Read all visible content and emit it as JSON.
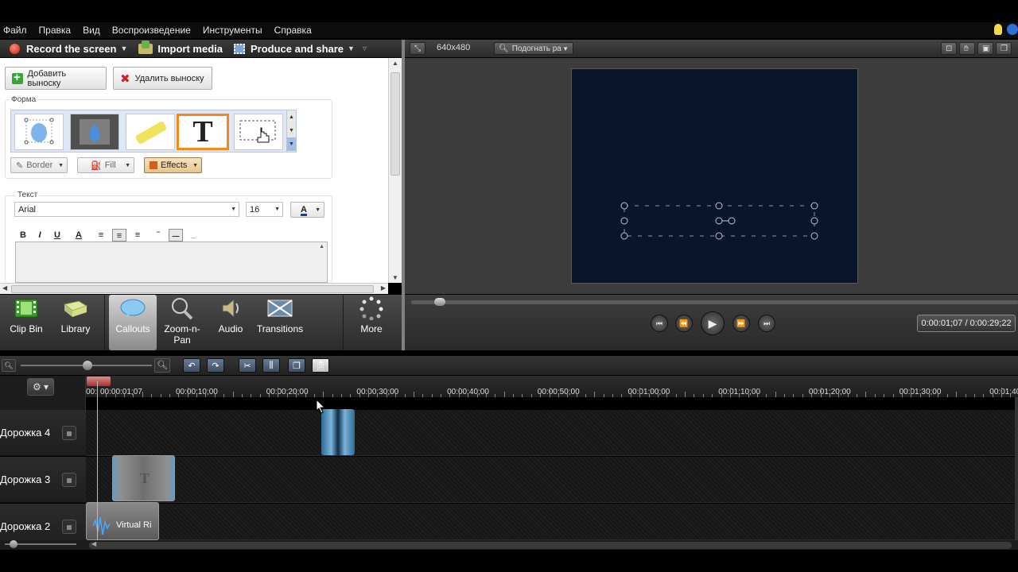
{
  "menu": [
    "Файл",
    "Правка",
    "Вид",
    "Воспроизведение",
    "Инструменты",
    "Справка"
  ],
  "toolbar": {
    "record": "Record the screen",
    "import": "Import media",
    "produce": "Produce and share"
  },
  "callout_panel": {
    "add_button": "Добавить выноску",
    "delete_button": "Удалить выноску",
    "shape_group": "Форма",
    "border": "Border",
    "fill": "Fill",
    "effects": "Effects",
    "text_group": "Текст",
    "font": "Arial",
    "size": "16",
    "color_glyph": "A",
    "format": [
      "B",
      "I",
      "U",
      "A"
    ]
  },
  "tabs": [
    {
      "label": "Clip Bin",
      "icon": "film-strip-icon"
    },
    {
      "label": "Library",
      "icon": "library-icon"
    },
    {
      "label": "Callouts",
      "icon": "callout-bubble-icon"
    },
    {
      "label": "Zoom-n-Pan",
      "icon": "magnifier-icon"
    },
    {
      "label": "Audio",
      "icon": "speaker-icon"
    },
    {
      "label": "Transitions",
      "icon": "transitions-icon"
    },
    {
      "label": "More",
      "icon": "more-dots-icon"
    }
  ],
  "preview": {
    "size": "640x480",
    "fit": "Подогнать ра",
    "timecode": "0:00:01;07 / 0:00:29;22"
  },
  "timeline": {
    "playhead_label": "00:00:01;07",
    "ruler_start": "00:",
    "ruler_labels": [
      "00:00:10;00",
      "00:00:20;00",
      "00:00:30;00",
      "00:00:40;00",
      "00:00:50;00",
      "00:01:00;00",
      "00:01:10;00",
      "00:01:20;00",
      "00:01:30;00",
      "00:01:40"
    ],
    "tracks": [
      {
        "label": "Дорожка 4"
      },
      {
        "label": "Дорожка 3"
      },
      {
        "label": "Дорожка 2",
        "clip_label": "Virtual Ri"
      }
    ]
  },
  "colors": {
    "accent_orange": "#f28a1a",
    "canvas_bg": "#09152a",
    "record_red": "#d11b0a"
  }
}
